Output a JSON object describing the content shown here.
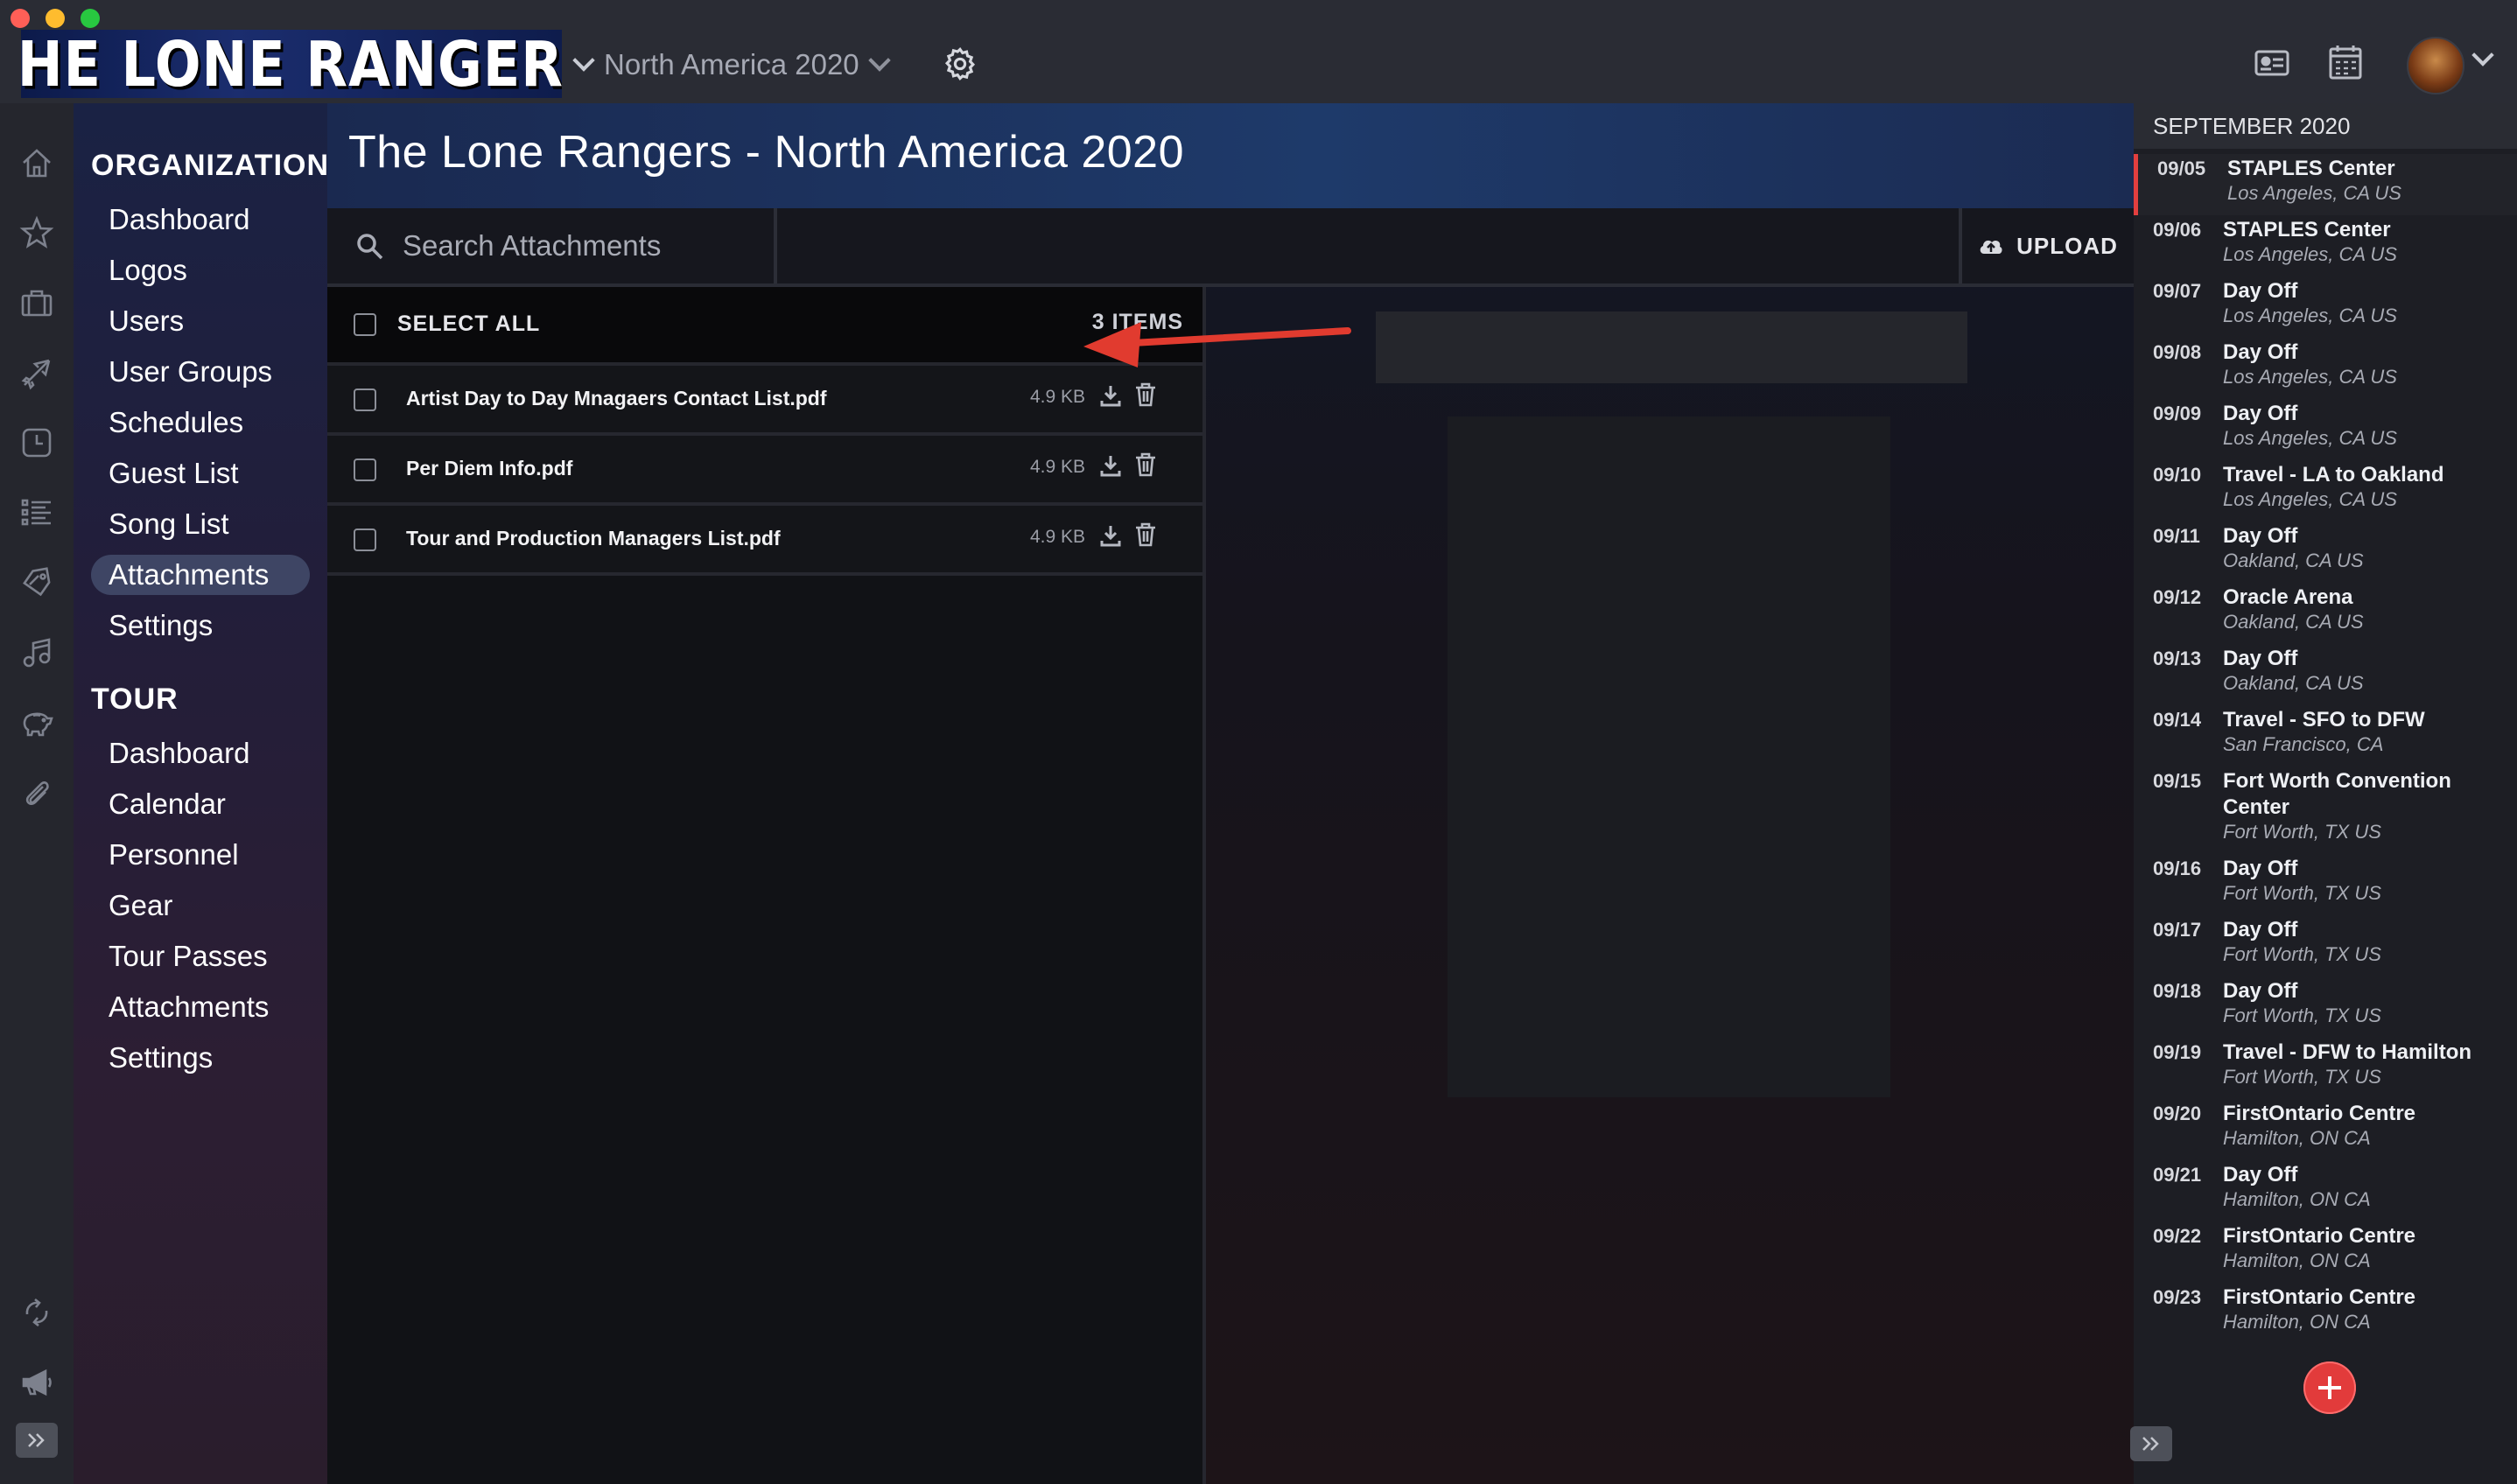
{
  "window": {
    "traffic_lights": [
      "#ff5f57",
      "#febc2e",
      "#28c840"
    ]
  },
  "topbar": {
    "logo_text": "THE LONE RANGERS",
    "tour_selector": "North America 2020",
    "icons": [
      "chevron-down-icon",
      "gear-icon",
      "id-card-icon",
      "calendar-icon",
      "avatar"
    ]
  },
  "rail": {
    "icons": [
      "home-icon",
      "star-icon",
      "briefcase-icon",
      "plane-icon",
      "clock-icon",
      "list-icon",
      "tag-icon",
      "music-icon",
      "piggy-bank-icon",
      "paperclip-icon",
      "sync-icon",
      "megaphone-icon",
      "expand-icon"
    ]
  },
  "nav": {
    "organization_heading": "ORGANIZATION",
    "organization_items": [
      "Dashboard",
      "Logos",
      "Users",
      "User Groups",
      "Schedules",
      "Guest List",
      "Song List",
      "Attachments",
      "Settings"
    ],
    "active_item": "Attachments",
    "tour_heading": "TOUR",
    "tour_items": [
      "Dashboard",
      "Calendar",
      "Personnel",
      "Gear",
      "Tour Passes",
      "Attachments",
      "Settings"
    ]
  },
  "main": {
    "title": "The Lone Rangers - North America 2020",
    "search_placeholder": "Search Attachments",
    "upload_label": "UPLOAD",
    "select_all_label": "SELECT ALL",
    "items_count": "3 ITEMS",
    "files": [
      {
        "name": "Artist Day to Day Mnagaers Contact List.pdf",
        "size": "4.9 KB"
      },
      {
        "name": "Per Diem Info.pdf",
        "size": "4.9 KB"
      },
      {
        "name": "Tour and Production Managers List.pdf",
        "size": "4.9 KB"
      }
    ]
  },
  "schedule": {
    "month": "SEPTEMBER 2020",
    "more_label": "•••",
    "items": [
      {
        "date": "09/05",
        "venue": "STAPLES Center",
        "location": "Los Angeles, CA US"
      },
      {
        "date": "09/06",
        "venue": "STAPLES Center",
        "location": "Los Angeles, CA US"
      },
      {
        "date": "09/07",
        "venue": "Day Off",
        "location": "Los Angeles, CA US"
      },
      {
        "date": "09/08",
        "venue": "Day Off",
        "location": "Los Angeles, CA US"
      },
      {
        "date": "09/09",
        "venue": "Day Off",
        "location": "Los Angeles, CA US"
      },
      {
        "date": "09/10",
        "venue": "Travel - LA to Oakland",
        "location": "Los Angeles, CA US"
      },
      {
        "date": "09/11",
        "venue": "Day Off",
        "location": "Oakland, CA US"
      },
      {
        "date": "09/12",
        "venue": "Oracle Arena",
        "location": "Oakland, CA US"
      },
      {
        "date": "09/13",
        "venue": "Day Off",
        "location": "Oakland, CA US"
      },
      {
        "date": "09/14",
        "venue": "Travel - SFO to DFW",
        "location": "San Francisco, CA"
      },
      {
        "date": "09/15",
        "venue": "Fort Worth Convention Center",
        "location": "Fort Worth, TX US"
      },
      {
        "date": "09/16",
        "venue": "Day Off",
        "location": "Fort Worth, TX US"
      },
      {
        "date": "09/17",
        "venue": "Day Off",
        "location": "Fort Worth, TX US"
      },
      {
        "date": "09/18",
        "venue": "Day Off",
        "location": "Fort Worth, TX US"
      },
      {
        "date": "09/19",
        "venue": "Travel - DFW to Hamilton",
        "location": "Fort Worth, TX US"
      },
      {
        "date": "09/20",
        "venue": "FirstOntario Centre",
        "location": "Hamilton, ON CA"
      },
      {
        "date": "09/21",
        "venue": "Day Off",
        "location": "Hamilton, ON CA"
      },
      {
        "date": "09/22",
        "venue": "FirstOntario Centre",
        "location": "Hamilton, ON CA"
      },
      {
        "date": "09/23",
        "venue": "FirstOntario Centre",
        "location": "Hamilton, ON CA"
      }
    ]
  },
  "colors": {
    "accent_red": "#e23b3b",
    "nav_active": "#3e4564",
    "title_band": "#1e3a6a"
  }
}
